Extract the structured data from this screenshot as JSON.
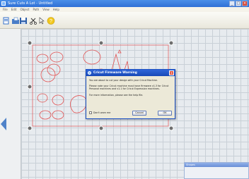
{
  "window": {
    "title": "Sure Cuts A Lot - Untitled"
  },
  "menu": {
    "items": [
      "File",
      "Edit",
      "Object",
      "Path",
      "View",
      "Help"
    ]
  },
  "dialog": {
    "title": "Cricut Firmware Warning",
    "paragraph1": "You are about to cut your design with your Cricut Machine.",
    "paragraph2": "Please note your Cricut machine must have firmware v1.3 for Cricut Personal machines and v1.1 for Cricut Expression machines.",
    "paragraph3": "For more information, please see the help file.",
    "checkbox_label": "Don't warn me",
    "cancel_label": "Cancel",
    "ok_label": "OK"
  },
  "panel": {
    "title": "Shapes"
  },
  "colors": {
    "accent": "#2f66d8",
    "cut_path": "#e25252",
    "mat_border": "#e25252"
  }
}
